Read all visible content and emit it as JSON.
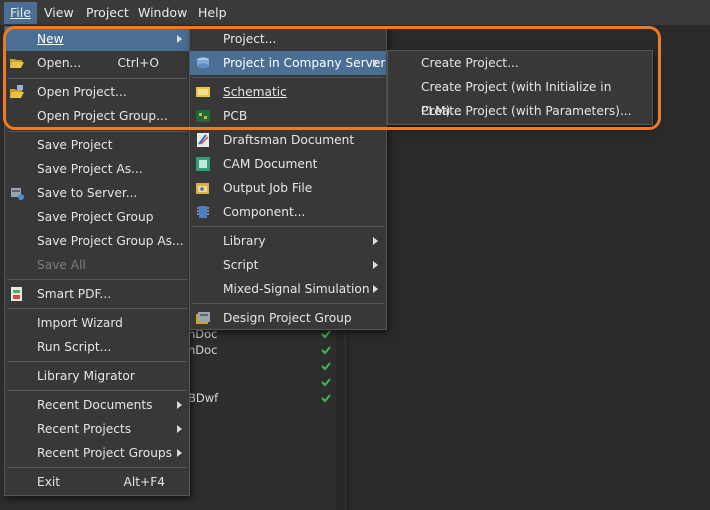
{
  "menubar": {
    "items": [
      "File",
      "View",
      "Project",
      "Window",
      "Help"
    ]
  },
  "background": {
    "rows": [
      "hDoc",
      "hDoc",
      "BDwf"
    ]
  },
  "file_menu": {
    "new": "New",
    "open": "Open...",
    "open_shortcut": "Ctrl+O",
    "open_project": "Open Project...",
    "open_project_group": "Open Project Group...",
    "save_project": "Save Project",
    "save_project_as": "Save Project As...",
    "save_to_server": "Save to Server...",
    "save_project_group": "Save Project Group",
    "save_project_group_as": "Save Project Group As...",
    "save_all": "Save All",
    "smart_pdf": "Smart PDF...",
    "import_wizard": "Import Wizard",
    "run_script": "Run Script...",
    "library_migrator": "Library Migrator",
    "recent_documents": "Recent Documents",
    "recent_projects": "Recent Projects",
    "recent_project_groups": "Recent Project Groups",
    "exit": "Exit",
    "exit_shortcut": "Alt+F4"
  },
  "new_menu": {
    "project": "Project...",
    "project_company_server": "Project in Company Server",
    "schematic": "Schematic",
    "pcb": "PCB",
    "draftsman_document": "Draftsman Document",
    "cam_document": "CAM Document",
    "output_job_file": "Output Job File",
    "component": "Component...",
    "library": "Library",
    "script": "Script",
    "mixed_signal_simulation": "Mixed-Signal Simulation",
    "design_project_group": "Design Project Group"
  },
  "server_menu": {
    "create_project": "Create Project...",
    "create_project_plm": "Create Project (with Initialize in PLM)...",
    "create_project_params": "Create Project (with Parameters)..."
  },
  "colors": {
    "highlight": "#4a6e94",
    "callout": "#ee7a24",
    "menu_bg": "#383838",
    "check": "#3fb950"
  }
}
